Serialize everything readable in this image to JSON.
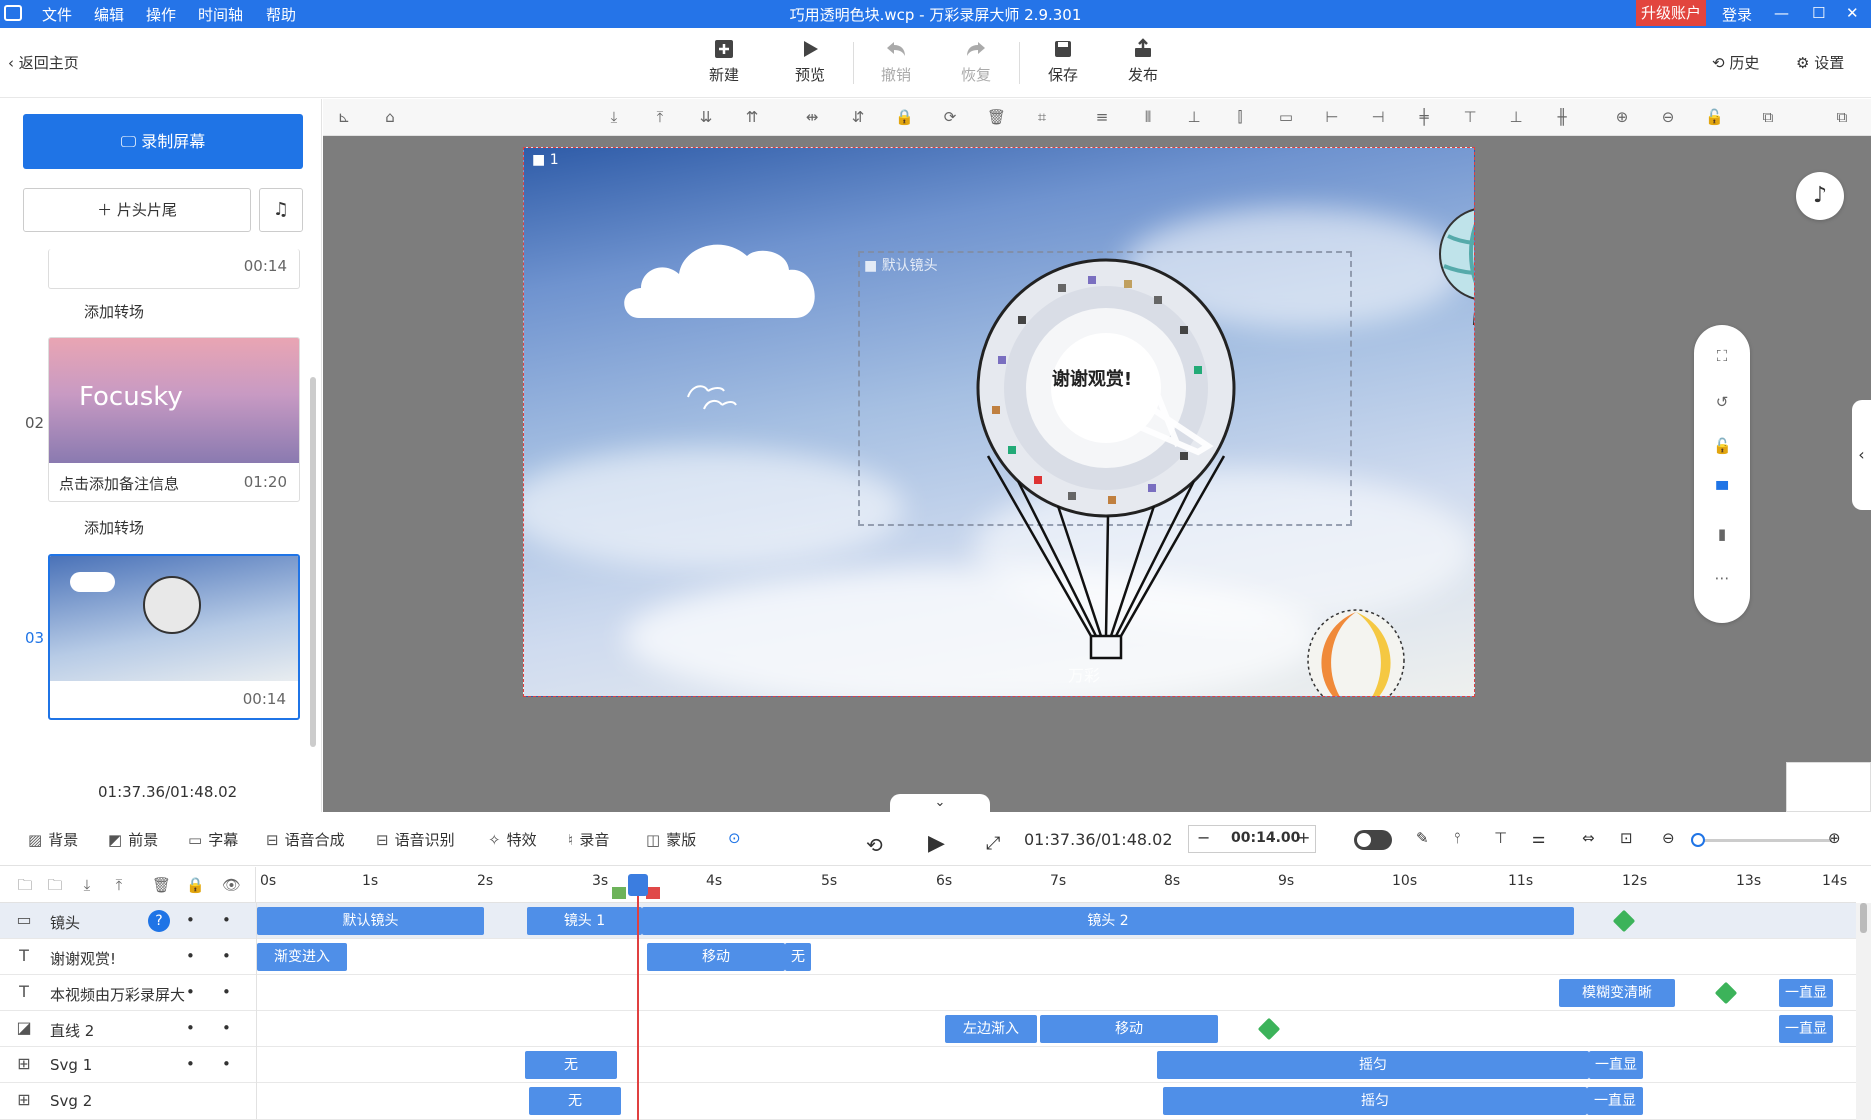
{
  "titlebar": {
    "menus": [
      "文件",
      "编辑",
      "操作",
      "时间轴",
      "帮助"
    ],
    "title": "巧用透明色块.wcp - 万彩录屏大师 2.9.301",
    "upgrade": "升级账户",
    "login": "登录"
  },
  "toolbar": {
    "back": "返回主页",
    "new": "新建",
    "preview": "预览",
    "undo": "撤销",
    "redo": "恢复",
    "save": "保存",
    "publish": "发布",
    "history": "历史",
    "settings": "设置"
  },
  "left": {
    "record": "录制屏幕",
    "headtail": "片头片尾",
    "cards": [
      {
        "num": "",
        "time": "00:14"
      },
      {
        "num": "02",
        "note": "点击添加备注信息",
        "time": "01:20",
        "thumb_text": "Focusky"
      },
      {
        "num": "03",
        "time": "00:14"
      }
    ],
    "add_transition": "添加转场",
    "total_time": "01:37.36/01:48.02"
  },
  "stage": {
    "scene_index": "1",
    "camera_label": "默认镜头",
    "thanks": "谢谢观赏!",
    "brand": "万彩"
  },
  "bottombar": {
    "items": [
      "背景",
      "前景",
      "字幕",
      "语音合成",
      "语音识别",
      "特效",
      "录音",
      "蒙版"
    ],
    "time": "01:37.36/01:48.02",
    "duration": "00:14.00",
    "zoom_level": 0.03
  },
  "timeline": {
    "ticks": [
      "0s",
      "1s",
      "2s",
      "3s",
      "4s",
      "5s",
      "6s",
      "7s",
      "8s",
      "9s",
      "10s",
      "11s",
      "12s",
      "13s",
      "14s"
    ],
    "tracks": [
      {
        "name": "镜头",
        "clips": [
          "默认镜头",
          "镜头 1",
          "镜头 2"
        ]
      },
      {
        "name": "谢谢观赏!",
        "clips": [
          "渐变进入",
          "移动",
          "无"
        ]
      },
      {
        "name": "本视频由万彩录屏大",
        "clips": [
          "模糊变清晰",
          "一直显"
        ]
      },
      {
        "name": "直线 2",
        "clips": [
          "左边渐入",
          "移动",
          "一直显"
        ]
      },
      {
        "name": "Svg 1",
        "clips": [
          "无",
          "摇匀",
          "一直显"
        ]
      },
      {
        "name": "Svg 2",
        "clips": [
          "无",
          "摇匀",
          "一直显"
        ]
      }
    ]
  },
  "colors": {
    "accent": "#2574e8",
    "clip": "#4f8fe8",
    "keyframe": "#3cb35a",
    "playhead": "#e04040"
  }
}
